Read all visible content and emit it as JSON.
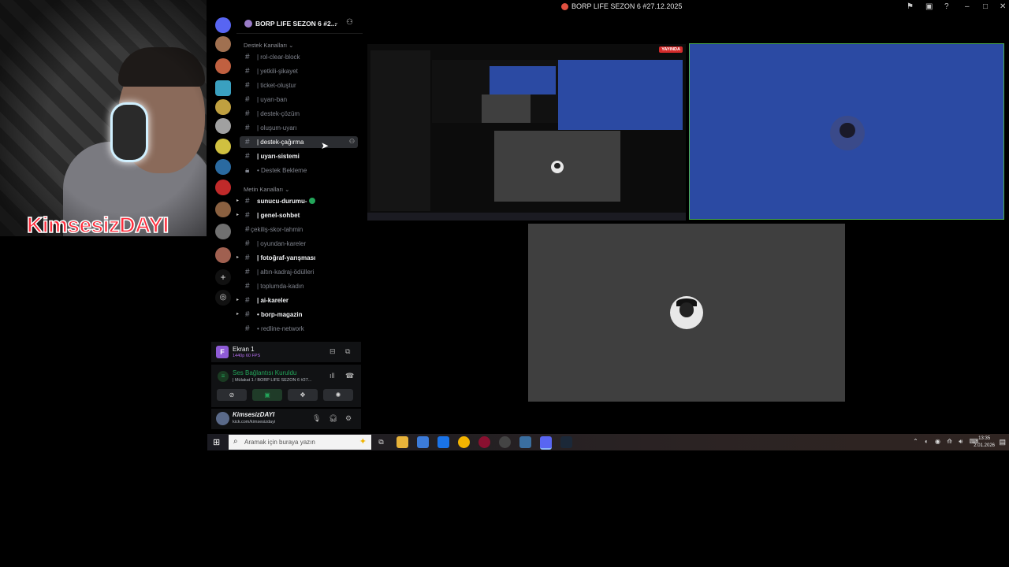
{
  "webcam": {
    "overlay_name": "KimsesizDAYI"
  },
  "window": {
    "title": "BORP LIFE SEZON 6 #27.12.2025",
    "controls": [
      "flag-icon",
      "screen-icon",
      "help-icon",
      "minimize",
      "maximize",
      "close"
    ]
  },
  "server": {
    "name": "BORP LIFE SEZON 6 #2..."
  },
  "categories": {
    "destek": "Destek Kanalları",
    "metin": "Metin Kanalları"
  },
  "destek_channels": [
    {
      "label": "| rol-clear-block"
    },
    {
      "label": "| yetkili-şikayet"
    },
    {
      "label": "| ticket-oluştur"
    },
    {
      "label": "| uyarı-ban"
    },
    {
      "label": "| destek-çözüm"
    },
    {
      "label": "| oluşum-uyarı"
    },
    {
      "label": "| destek-çağırma"
    },
    {
      "label": "| uyarı-sistemi"
    },
    {
      "label": "• Destek Bekleme"
    }
  ],
  "metin_channels": [
    {
      "label": "sunucu-durumu-"
    },
    {
      "label": "| genel-sohbet"
    },
    {
      "label": "çekiliş-skor-tahmin"
    },
    {
      "label": "| oyundan-kareler"
    },
    {
      "label": "| fotoğraf-yarışması"
    },
    {
      "label": "| altın-kadraj-ödülleri"
    },
    {
      "label": "| toplumda-kadın"
    },
    {
      "label": "| ai-kareler"
    },
    {
      "label": "• borp-magazin"
    },
    {
      "label": "• redline-network"
    }
  ],
  "screen_share": {
    "title": "Ekran 1",
    "quality": "1440p 60 FPS"
  },
  "voice": {
    "status": "Ses Bağlantısı Kuruldu",
    "channel": "| Mülakat 1 / BORP LIFE SEZON 6 #27..."
  },
  "user": {
    "name": "KimsesizDAYI",
    "status": "kick.com/kimsesizdayi"
  },
  "stage": {
    "live_badge": "YAYINDA"
  },
  "taskbar": {
    "search_placeholder": "Aramak için buraya yazın",
    "time": "13:35",
    "date": "2.01.2026"
  }
}
